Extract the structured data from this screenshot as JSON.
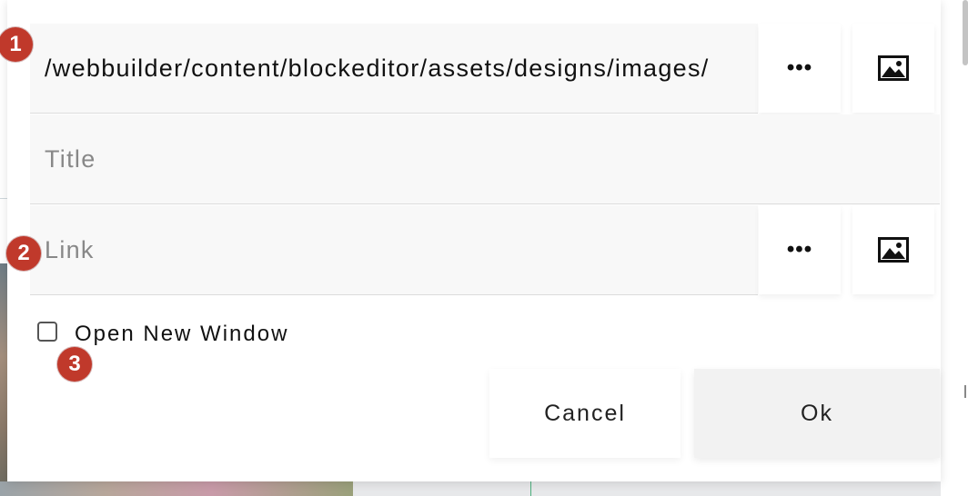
{
  "dialog": {
    "image_path": {
      "value": "/webbuilder/content/blockeditor/assets/designs/images/"
    },
    "title_field": {
      "placeholder": "Title"
    },
    "link_field": {
      "placeholder": "Link"
    },
    "browse_button_glyph": "•••",
    "image_button_icon": "image-icon",
    "open_new_window": {
      "label": "Open New Window",
      "checked": false
    },
    "cancel_label": "Cancel",
    "ok_label": "Ok"
  },
  "markers": [
    "1",
    "2",
    "3"
  ],
  "colors": {
    "marker": "#c0392b",
    "field_bg": "#f8f8f8",
    "ok_bg": "#f2f2f2"
  }
}
